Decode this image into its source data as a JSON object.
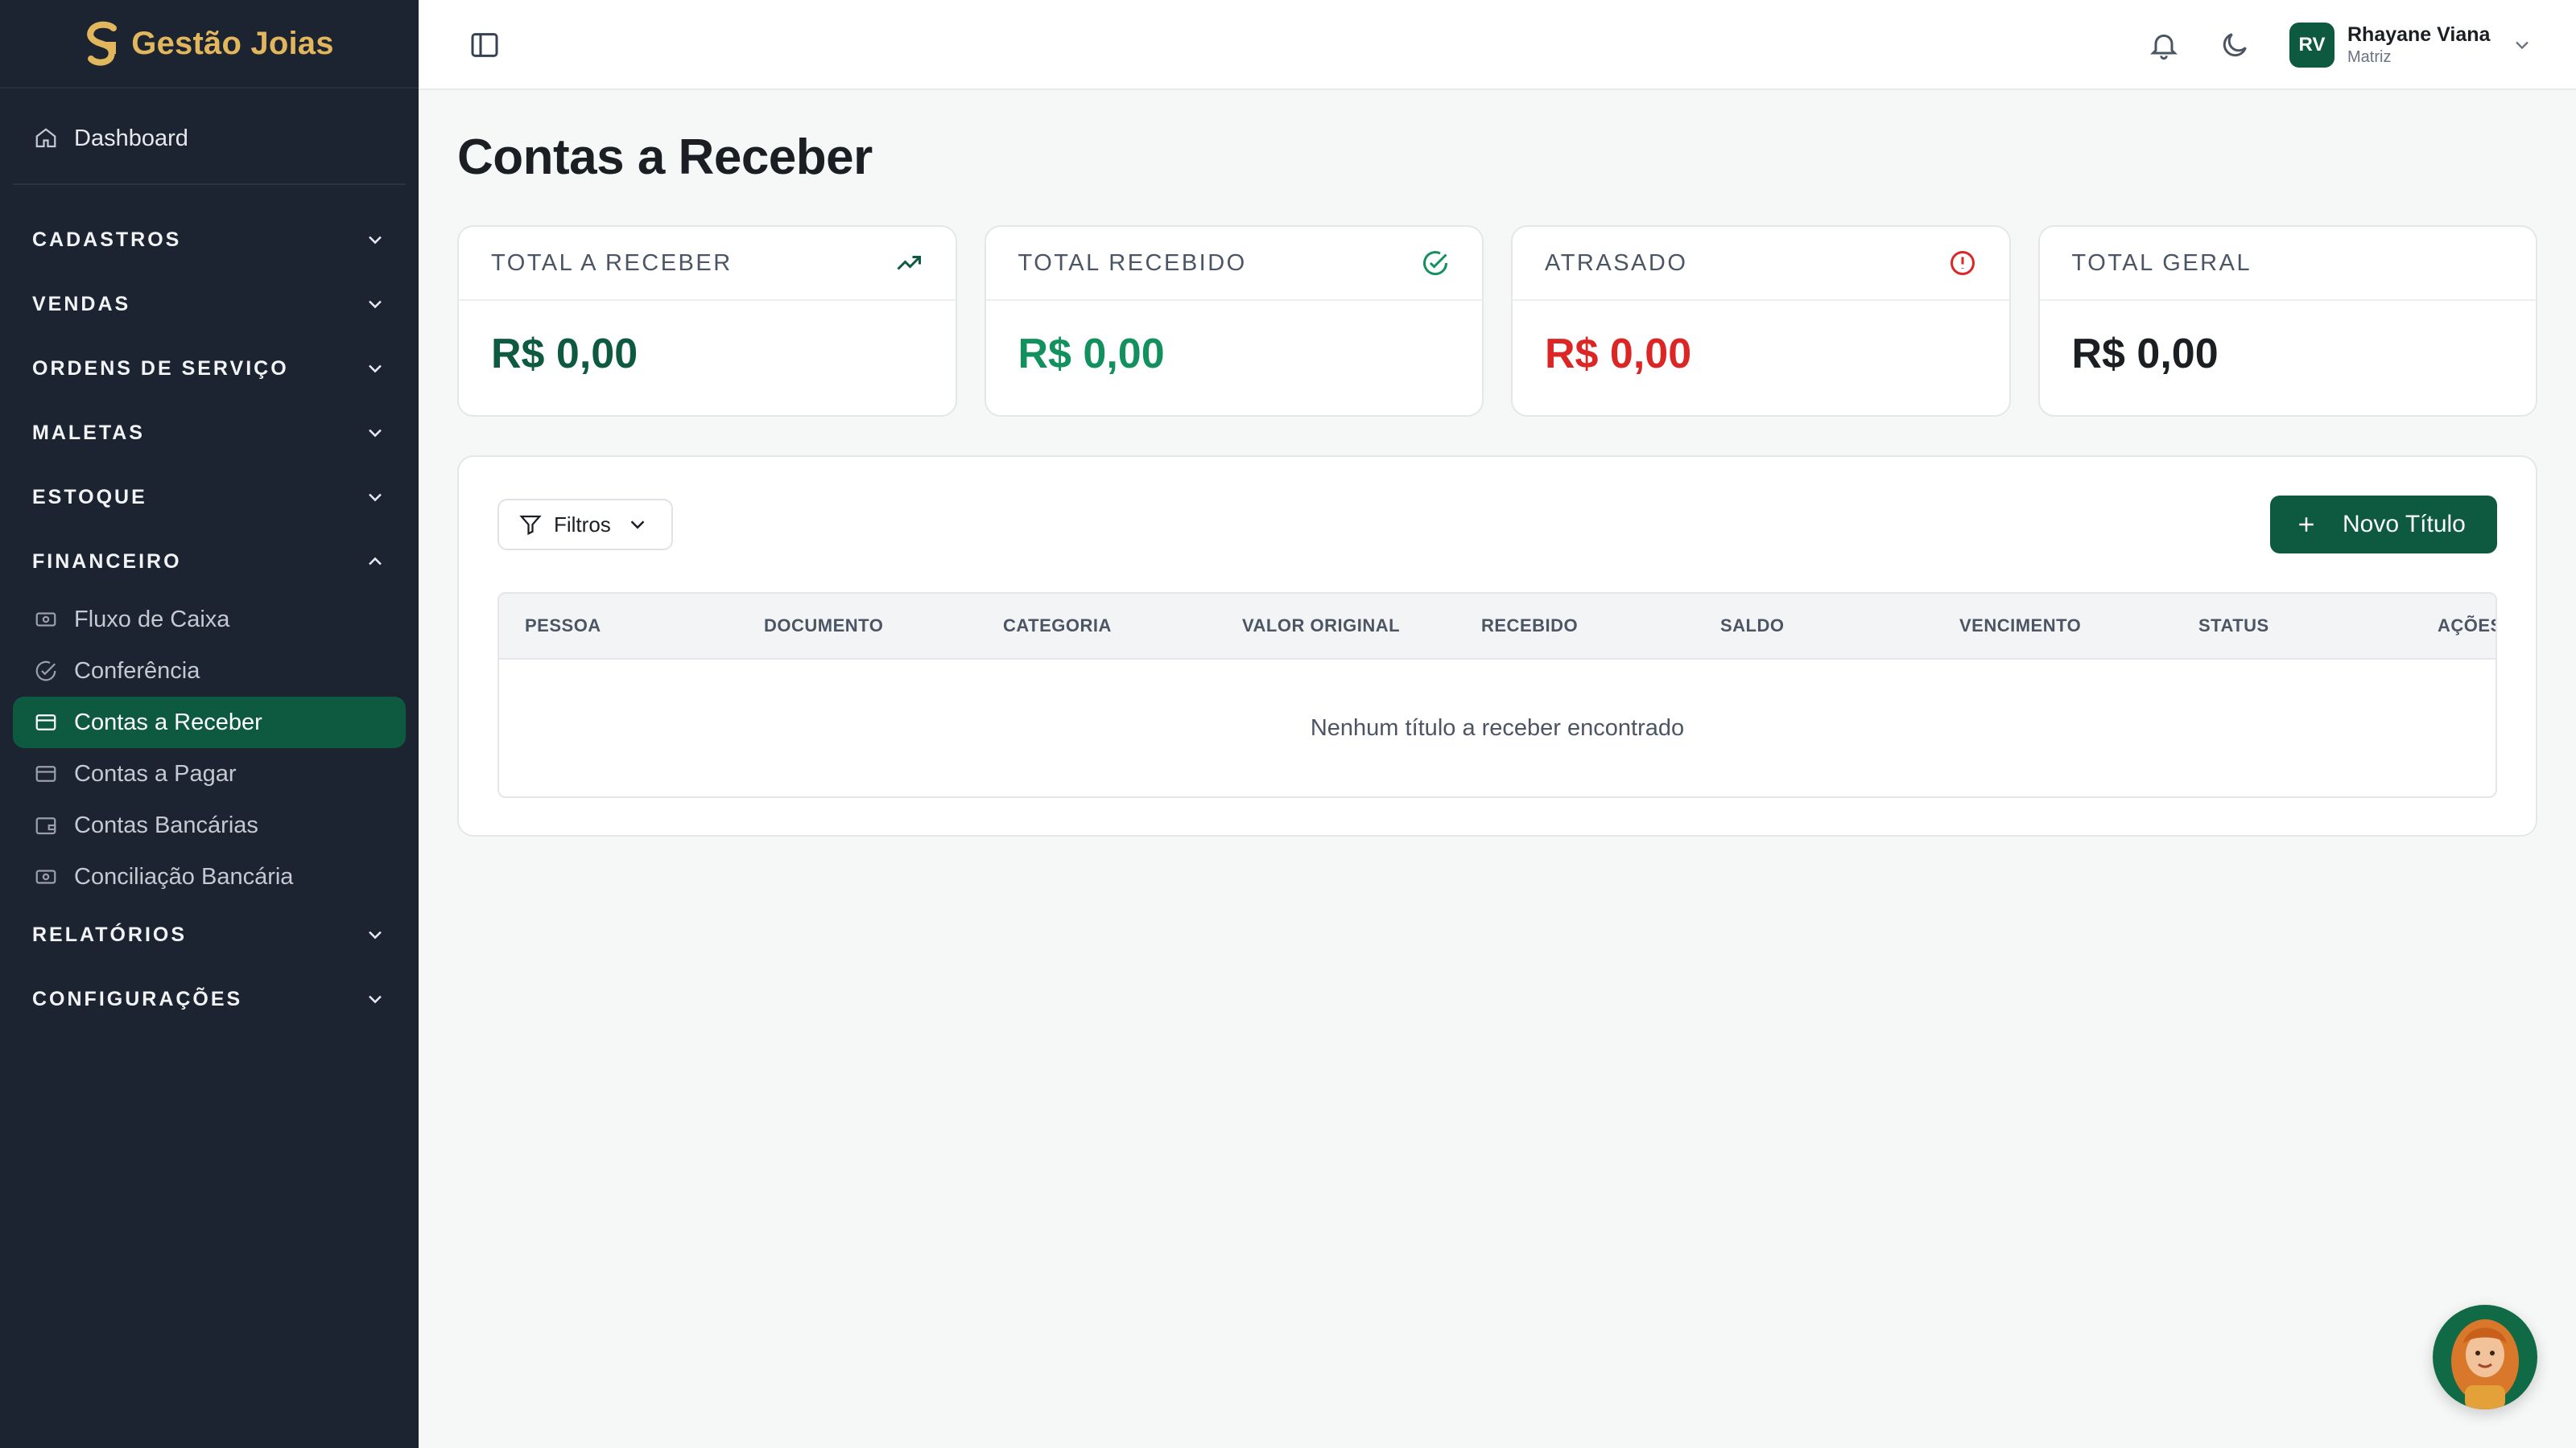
{
  "brand": {
    "name": "Gestão Joias",
    "color": "#e2b65c"
  },
  "sidebar": {
    "dashboard": {
      "label": "Dashboard",
      "icon": "home-icon"
    },
    "sections": [
      {
        "label": "CADASTROS",
        "expanded": false
      },
      {
        "label": "VENDAS",
        "expanded": false
      },
      {
        "label": "ORDENS DE SERVIÇO",
        "expanded": false
      },
      {
        "label": "MALETAS",
        "expanded": false
      },
      {
        "label": "ESTOQUE",
        "expanded": false
      },
      {
        "label": "FINANCEIRO",
        "expanded": true
      }
    ],
    "financeiro_items": [
      {
        "label": "Fluxo de Caixa",
        "icon": "banknote-icon"
      },
      {
        "label": "Conferência",
        "icon": "check-circle-icon"
      },
      {
        "label": "Contas a Receber",
        "icon": "credit-card-icon",
        "active": true
      },
      {
        "label": "Contas a Pagar",
        "icon": "credit-card-icon"
      },
      {
        "label": "Contas Bancárias",
        "icon": "wallet-icon"
      },
      {
        "label": "Conciliação Bancária",
        "icon": "banknote-icon"
      }
    ],
    "sections_after": [
      {
        "label": "RELATÓRIOS",
        "expanded": false
      },
      {
        "label": "CONFIGURAÇÕES",
        "expanded": false
      }
    ]
  },
  "header": {
    "user_initials": "RV",
    "user_name": "Rhayane Viana",
    "user_role": "Matriz"
  },
  "page": {
    "title": "Contas a Receber"
  },
  "cards": [
    {
      "label": "TOTAL A RECEBER",
      "value": "R$ 0,00",
      "icon": "trending-up-icon",
      "color": "#0e5a40"
    },
    {
      "label": "TOTAL RECEBIDO",
      "value": "R$ 0,00",
      "icon": "check-circle-icon",
      "color": "#12915f"
    },
    {
      "label": "ATRASADO",
      "value": "R$ 0,00",
      "icon": "alert-circle-icon",
      "color": "#dc2626"
    },
    {
      "label": "TOTAL GERAL",
      "value": "R$ 0,00",
      "icon": "",
      "color": "#1b1f24"
    }
  ],
  "toolbar": {
    "filter_label": "Filtros",
    "new_label": "Novo Título"
  },
  "table": {
    "columns": [
      "PESSOA",
      "DOCUMENTO",
      "CATEGORIA",
      "VALOR ORIGINAL",
      "RECEBIDO",
      "SALDO",
      "VENCIMENTO",
      "STATUS",
      "AÇÕES"
    ],
    "empty_message": "Nenhum título a receber encontrado"
  },
  "colors": {
    "primary": "#0e5a40",
    "sidebar_bg": "#1c2331",
    "danger": "#dc2626",
    "success": "#12915f"
  }
}
